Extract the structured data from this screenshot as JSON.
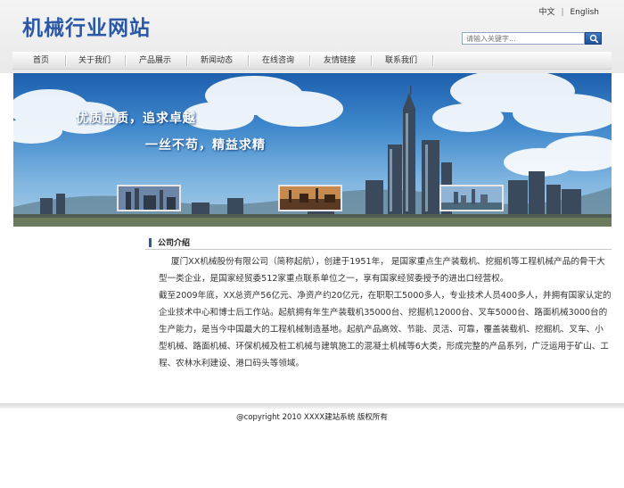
{
  "header": {
    "site_title": "机械行业网站",
    "lang_cn": "中文",
    "lang_sep": "|",
    "lang_en": "English",
    "search_placeholder": "请输入关键字..."
  },
  "nav": {
    "items": [
      {
        "label": "首页"
      },
      {
        "label": "关于我们"
      },
      {
        "label": "产品展示"
      },
      {
        "label": "新闻动态"
      },
      {
        "label": "在线咨询"
      },
      {
        "label": "友情链接"
      },
      {
        "label": "联系我们"
      }
    ]
  },
  "banner": {
    "slogan_1": "优质品质，追求卓越",
    "slogan_2": "一丝不苟，精益求精",
    "colors": {
      "sky_top": "#1d5fae",
      "sky_bottom": "#a8cbe6"
    }
  },
  "intro": {
    "heading": "公司介绍",
    "paragraph_1": "厦门XX机械股份有限公司（简称起航），创建于1951年， 是国家重点生产装载机、挖掘机等工程机械产品的骨干大型一类企业，是国家经贸委512家重点联系单位之一，享有国家经贸委授予的进出口经营权。",
    "paragraph_2": "截至2009年底，XX总资产56亿元、净资产约20亿元，在职职工5000多人，专业技术人员400多人，并拥有国家认定的企业技术中心和博士后工作站。起航拥有年生产装载机35000台、挖掘机12000台、叉车5000台、路面机械3000台的生产能力，是当今中国最大的工程机械制造基地。起航产品高效、节能、灵活、可靠，覆盖装载机、挖掘机、叉车、小型机械、路面机械、环保机械及桩工机械与建筑施工的混凝土机械等6大类，形成完整的产品系列，广泛运用于矿山、工程、农林水利建设、港口码头等领域。"
  },
  "footer": {
    "copyright": "@copyright  2010 XXXX建站系统  版权所有"
  },
  "accent_color": "#2a58a7"
}
